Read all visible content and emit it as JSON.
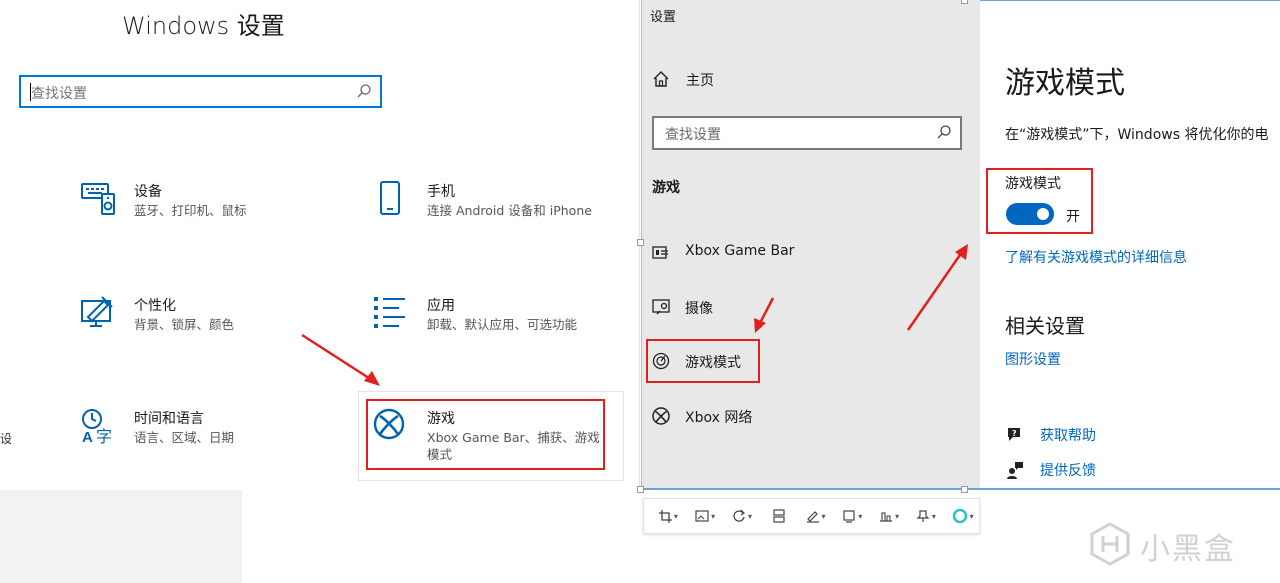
{
  "left_window": {
    "title": "Windows 设置",
    "search_placeholder": "查找设置",
    "tiles": [
      {
        "name": "设备",
        "desc": "蓝牙、打印机、鼠标",
        "icon": "keyboard-speaker-icon"
      },
      {
        "name": "手机",
        "desc": "连接 Android 设备和 iPhone",
        "icon": "phone-icon"
      },
      {
        "name": "个性化",
        "desc": "背景、锁屏、颜色",
        "icon": "paint-monitor-icon"
      },
      {
        "name": "应用",
        "desc": "卸载、默认应用、可选功能",
        "icon": "apps-list-icon"
      },
      {
        "name": "时间和语言",
        "desc": "语言、区域、日期",
        "icon": "time-language-icon"
      },
      {
        "name": "游戏",
        "desc": "Xbox Game Bar、捕获、游戏模式",
        "icon": "xbox-icon"
      }
    ],
    "cut_text": "设"
  },
  "right_window": {
    "title": "设置",
    "home_label": "主页",
    "search_placeholder": "查找设置",
    "section_label": "游戏",
    "nav_items": [
      {
        "label": "Xbox Game Bar",
        "icon": "game-bar-icon"
      },
      {
        "label": "摄像",
        "icon": "capture-icon"
      },
      {
        "label": "游戏模式",
        "icon": "game-mode-icon"
      },
      {
        "label": "Xbox 网络",
        "icon": "xbox-icon"
      }
    ],
    "content": {
      "heading": "游戏模式",
      "description": "在“游戏模式”下，Windows 将优化你的电",
      "toggle_label": "游戏模式",
      "toggle_state": "开",
      "toggle_on": true,
      "learn_more": "了解有关游戏模式的详细信息",
      "related_heading": "相关设置",
      "graphics_link": "图形设置",
      "help_label": "获取帮助",
      "feedback_label": "提供反馈"
    }
  },
  "watermark": {
    "text": "小黑盒"
  },
  "colors": {
    "accent": "#0067c0",
    "highlight_box": "#e0201c",
    "nav_bg": "#e8e8e8"
  }
}
